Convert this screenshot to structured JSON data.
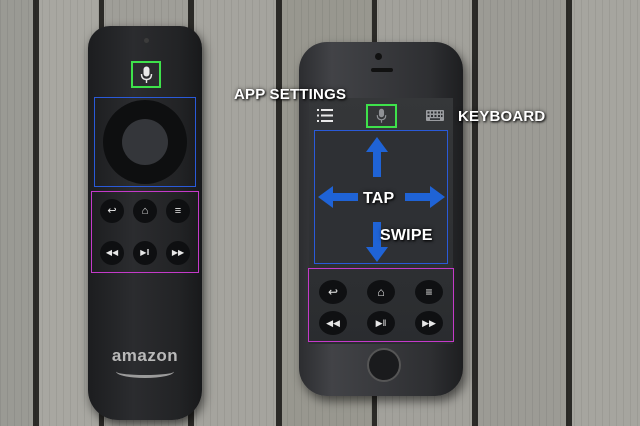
{
  "labels": {
    "app_settings": "APP SETTINGS",
    "keyboard": "KEYBOARD",
    "tap": "TAP",
    "swipe": "SWIPE",
    "brand": "amazon"
  },
  "colors": {
    "mic_highlight": "#3ee24b",
    "dpad_highlight": "#2a5ad9",
    "buttons_highlight": "#c43ac9",
    "arrow": "#1f63d6"
  },
  "remote_buttons": [
    {
      "name": "back-icon",
      "glyph": "↩"
    },
    {
      "name": "home-icon",
      "glyph": "⌂"
    },
    {
      "name": "menu-icon",
      "glyph": "≡"
    },
    {
      "name": "rewind-icon",
      "glyph": "◀◀"
    },
    {
      "name": "play-pause-icon",
      "glyph": "▶ǁ"
    },
    {
      "name": "fast-forward-icon",
      "glyph": "▶▶"
    }
  ]
}
